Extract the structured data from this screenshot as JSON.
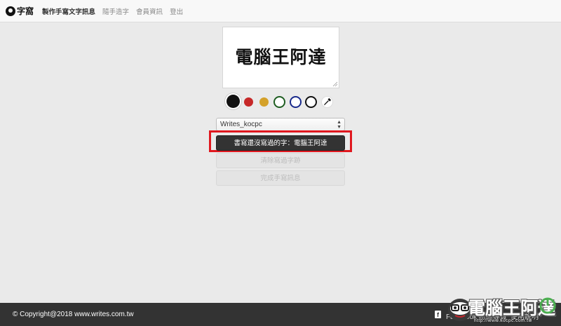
{
  "nav": {
    "brand": "字窩",
    "links": [
      "製作手寫文字訊息",
      "隨手造字",
      "會員資訊",
      "登出"
    ]
  },
  "canvas": {
    "text": "電腦王阿達"
  },
  "swatches": [
    {
      "name": "black",
      "color": "#111111",
      "selected": true
    },
    {
      "name": "red",
      "color": "#c62828"
    },
    {
      "name": "gold",
      "color": "#d4a12a"
    },
    {
      "name": "green",
      "color": "#1f5e22",
      "outline": true
    },
    {
      "name": "blue",
      "color": "#1a2b8c",
      "outline": true
    },
    {
      "name": "black-outline",
      "color": "#111111",
      "outline": true
    }
  ],
  "writer_select": {
    "value": "Writes_kocpc"
  },
  "buttons": {
    "write_unwritten": "書寫還沒寫過的字：電腦王阿達",
    "clear_written": "清除寫過字跡",
    "finish_message": "完成手寫訊息"
  },
  "footer": {
    "copyright": "© Copyright@2018 www.writes.com.tw",
    "link1": "Facebook 粉絲專頁",
    "link2": "使用說明"
  },
  "watermark": {
    "title": "電腦王阿達",
    "url": "http://www.kocpc.com.tw"
  },
  "colors": {
    "highlight": "#e0181f",
    "footer": "#333333",
    "primary_button": "#333333"
  }
}
